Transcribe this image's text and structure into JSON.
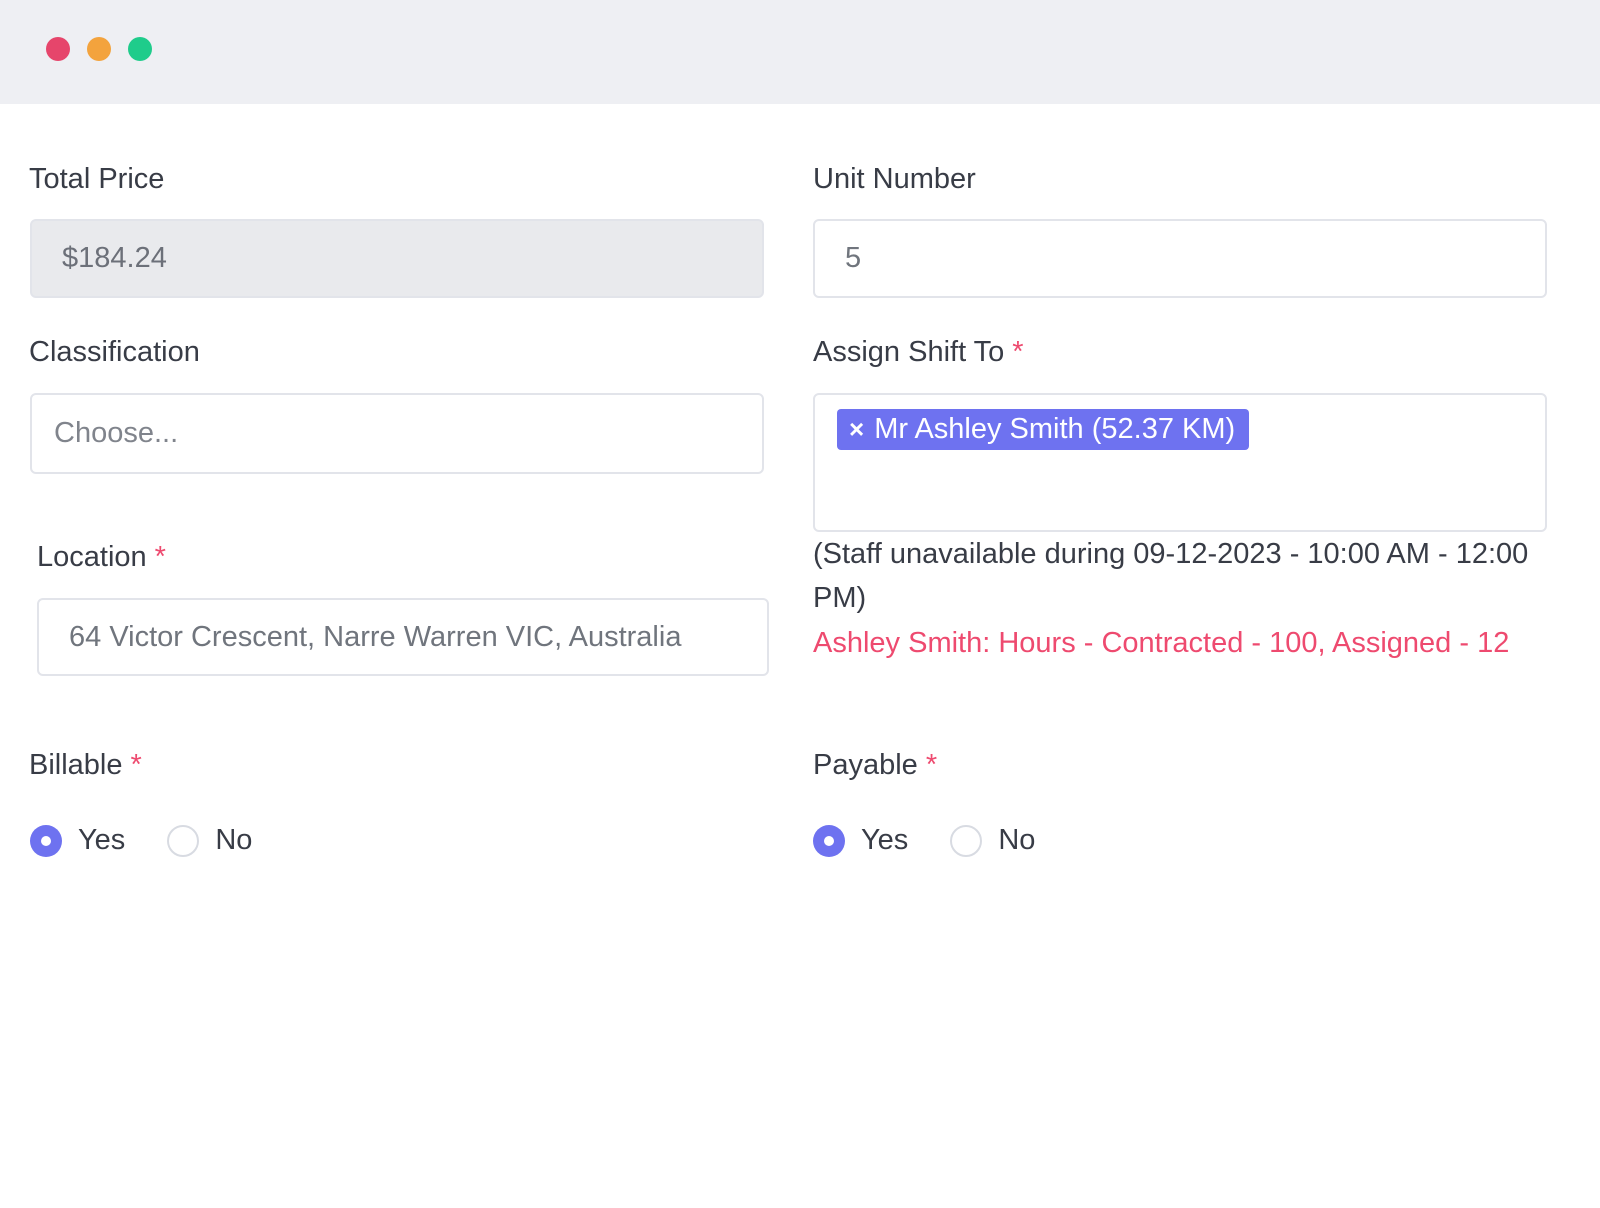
{
  "window": {
    "controls": [
      "close",
      "minimize",
      "maximize"
    ],
    "colors": {
      "close": "#e6456b",
      "minimize": "#f3a33d",
      "maximize": "#1fcc8b"
    }
  },
  "form": {
    "total_price": {
      "label": "Total Price",
      "value": "$184.24",
      "disabled": true
    },
    "unit_number": {
      "label": "Unit Number",
      "value": "5"
    },
    "classification": {
      "label": "Classification",
      "placeholder": "Choose..."
    },
    "assign_shift": {
      "label": "Assign Shift To",
      "required_mark": "*",
      "tag": {
        "remove_glyph": "×",
        "text": "Mr Ashley Smith (52.37 KM)"
      },
      "availability_note": "(Staff unavailable during 09-12-2023 - 10:00 AM - 12:00 PM)",
      "hours_warning": "Ashley Smith: Hours - Contracted - 100, Assigned - 12"
    },
    "location": {
      "label": "Location",
      "required_mark": "*",
      "value": "64 Victor Crescent, Narre Warren VIC, Australia"
    },
    "billable": {
      "label": "Billable",
      "required_mark": "*",
      "options": [
        "Yes",
        "No"
      ],
      "selected": "Yes"
    },
    "payable": {
      "label": "Payable",
      "required_mark": "*",
      "options": [
        "Yes",
        "No"
      ],
      "selected": "Yes"
    }
  },
  "theme": {
    "accent": "#6e72f0",
    "required": "#ee4a6f"
  }
}
